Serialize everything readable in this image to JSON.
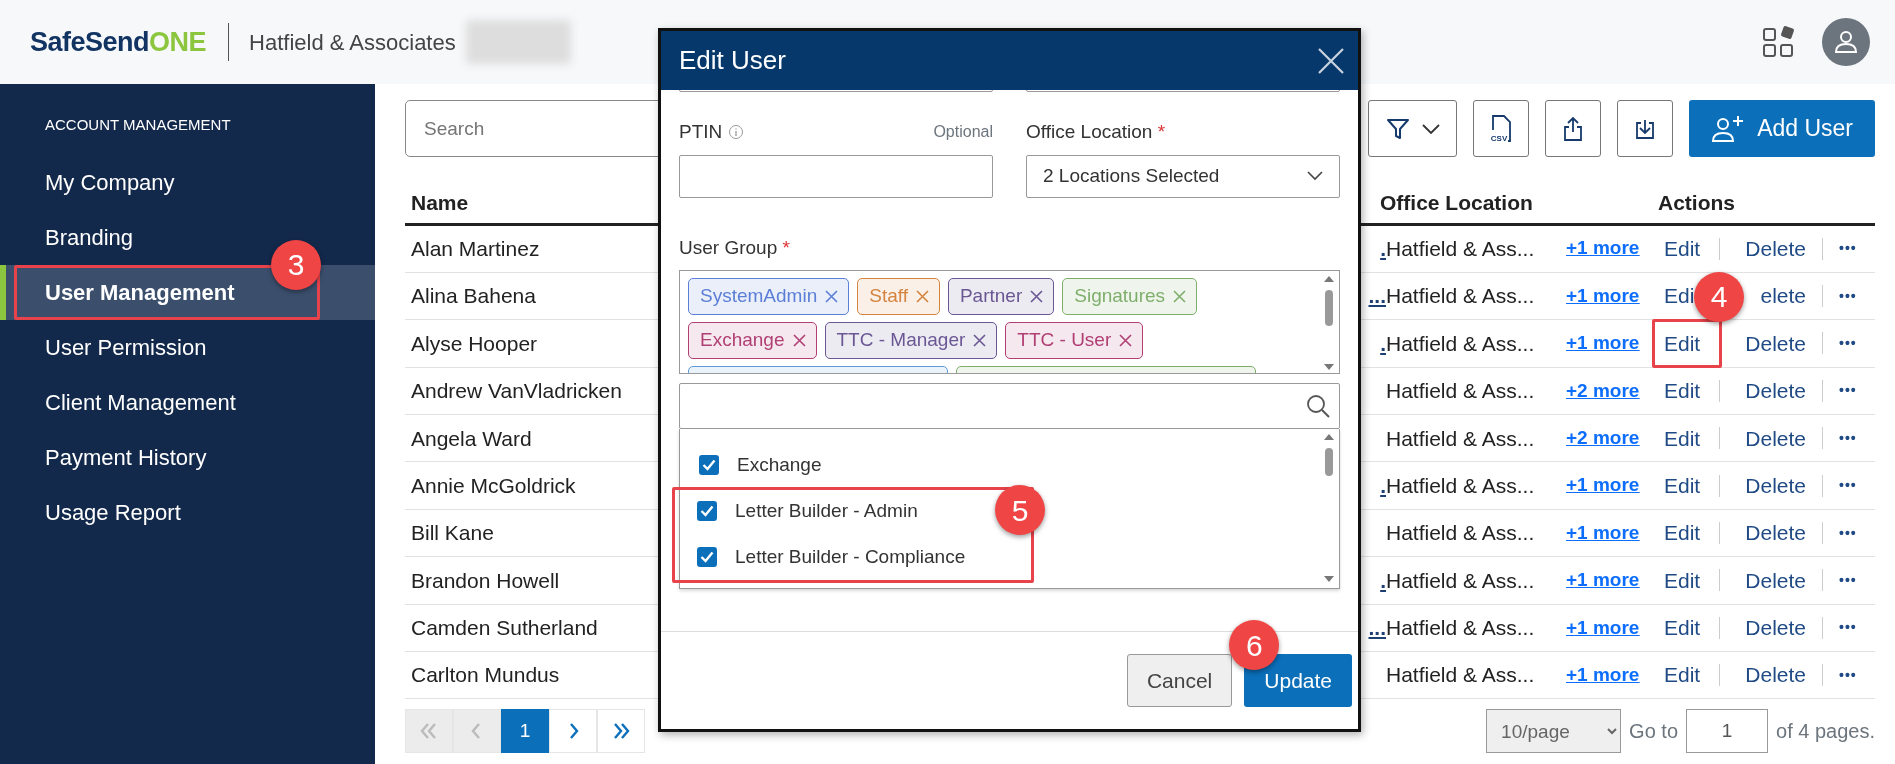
{
  "header": {
    "logo_main": "SafeSend",
    "logo_accent": "ONE",
    "company": "Hatfield & Associates"
  },
  "sidebar": {
    "heading": "ACCOUNT MANAGEMENT",
    "items": [
      {
        "label": "My Company",
        "selected": false
      },
      {
        "label": "Branding",
        "selected": false
      },
      {
        "label": "User Management",
        "selected": true,
        "callout": "3"
      },
      {
        "label": "User Permission",
        "selected": false
      },
      {
        "label": "Client Management",
        "selected": false
      },
      {
        "label": "Payment History",
        "selected": false
      },
      {
        "label": "Usage Report",
        "selected": false
      }
    ]
  },
  "toolbar": {
    "search_placeholder": "Search",
    "csv_label": "CSV",
    "add_button": "Add User"
  },
  "table": {
    "columns": [
      "Name",
      "Office Location",
      "Actions"
    ],
    "rows": [
      {
        "name": "Alan Martinez",
        "hidden_tail": ".",
        "office": "Hatfield & Ass...",
        "more": "+1 more",
        "edit": "Edit",
        "delete": "Delete",
        "menu": "•••"
      },
      {
        "name": "Alina Bahena",
        "hidden_tail": "...",
        "office": "Hatfield & Ass...",
        "more": "+1 more",
        "edit": "Edi",
        "delete": "elete",
        "menu": "•••"
      },
      {
        "name": "Alyse Hooper",
        "hidden_tail": ".",
        "office": "Hatfield & Ass...",
        "more": "+1 more",
        "edit": "Edit",
        "delete": "Delete",
        "menu": "•••",
        "edit_callout": "4"
      },
      {
        "name": "Andrew VanVladricken",
        "office": "Hatfield & Ass...",
        "more": "+2 more",
        "edit": "Edit",
        "delete": "Delete",
        "menu": "•••"
      },
      {
        "name": "Angela Ward",
        "office": "Hatfield & Ass...",
        "more": "+2 more",
        "edit": "Edit",
        "delete": "Delete",
        "menu": "•••"
      },
      {
        "name": "Annie McGoldrick",
        "hidden_tail": ".",
        "office": "Hatfield & Ass...",
        "more": "+1 more",
        "edit": "Edit",
        "delete": "Delete",
        "menu": "•••"
      },
      {
        "name": "Bill Kane",
        "office": "Hatfield & Ass...",
        "more": "+1 more",
        "edit": "Edit",
        "delete": "Delete",
        "menu": "•••"
      },
      {
        "name": "Brandon Howell",
        "hidden_tail": ".",
        "office": "Hatfield & Ass...",
        "more": "+1 more",
        "edit": "Edit",
        "delete": "Delete",
        "menu": "•••"
      },
      {
        "name": "Camden Sutherland",
        "hidden_tail": "...",
        "office": "Hatfield & Ass...",
        "more": "+1 more",
        "edit": "Edit",
        "delete": "Delete",
        "menu": "•••"
      },
      {
        "name": "Carlton Mundus",
        "office": "Hatfield & Ass...",
        "more": "+1 more",
        "edit": "Edit",
        "delete": "Delete",
        "menu": "•••"
      }
    ]
  },
  "pagination": {
    "nav": [
      {
        "kind": "first",
        "disabled": true
      },
      {
        "kind": "prev",
        "disabled": true
      },
      {
        "kind": "page",
        "label": "1",
        "selected": true
      },
      {
        "kind": "next",
        "disabled": false
      },
      {
        "kind": "last",
        "disabled": false
      }
    ],
    "page_size": "10/page",
    "goto_label": "Go to",
    "goto_value": "1",
    "total": "of 4 pages."
  },
  "modal": {
    "title": "Edit User",
    "ptin": {
      "label": "PTIN",
      "hint": "Optional"
    },
    "office": {
      "label": "Office Location",
      "required_mark": "*",
      "value": "2 Locations Selected"
    },
    "user_group": {
      "label": "User Group",
      "required_mark": "*",
      "tags": [
        {
          "label": "SystemAdmin",
          "color": "#5b7fd6"
        },
        {
          "label": "Staff",
          "color": "#d4843e"
        },
        {
          "label": "Partner",
          "color": "#6a5794"
        },
        {
          "label": "Signatures",
          "color": "#7fae6b"
        },
        {
          "label": "Exchange",
          "color": "#b03f74"
        },
        {
          "label": "TTC - Manager",
          "color": "#6a5794"
        },
        {
          "label": "TTC - User",
          "color": "#b03f74"
        },
        {
          "color": "#5b9bd6"
        },
        {
          "color": "#7fae6b"
        }
      ],
      "options": [
        {
          "label": "Exchange",
          "checked": true,
          "highlighted": false
        },
        {
          "label": "Letter Builder - Admin",
          "checked": true,
          "highlighted": true
        },
        {
          "label": "Letter Builder - Compliance",
          "checked": true,
          "highlighted": true
        }
      ],
      "options_callout": "5"
    },
    "cancel": "Cancel",
    "update": "Update",
    "update_callout": "6"
  }
}
